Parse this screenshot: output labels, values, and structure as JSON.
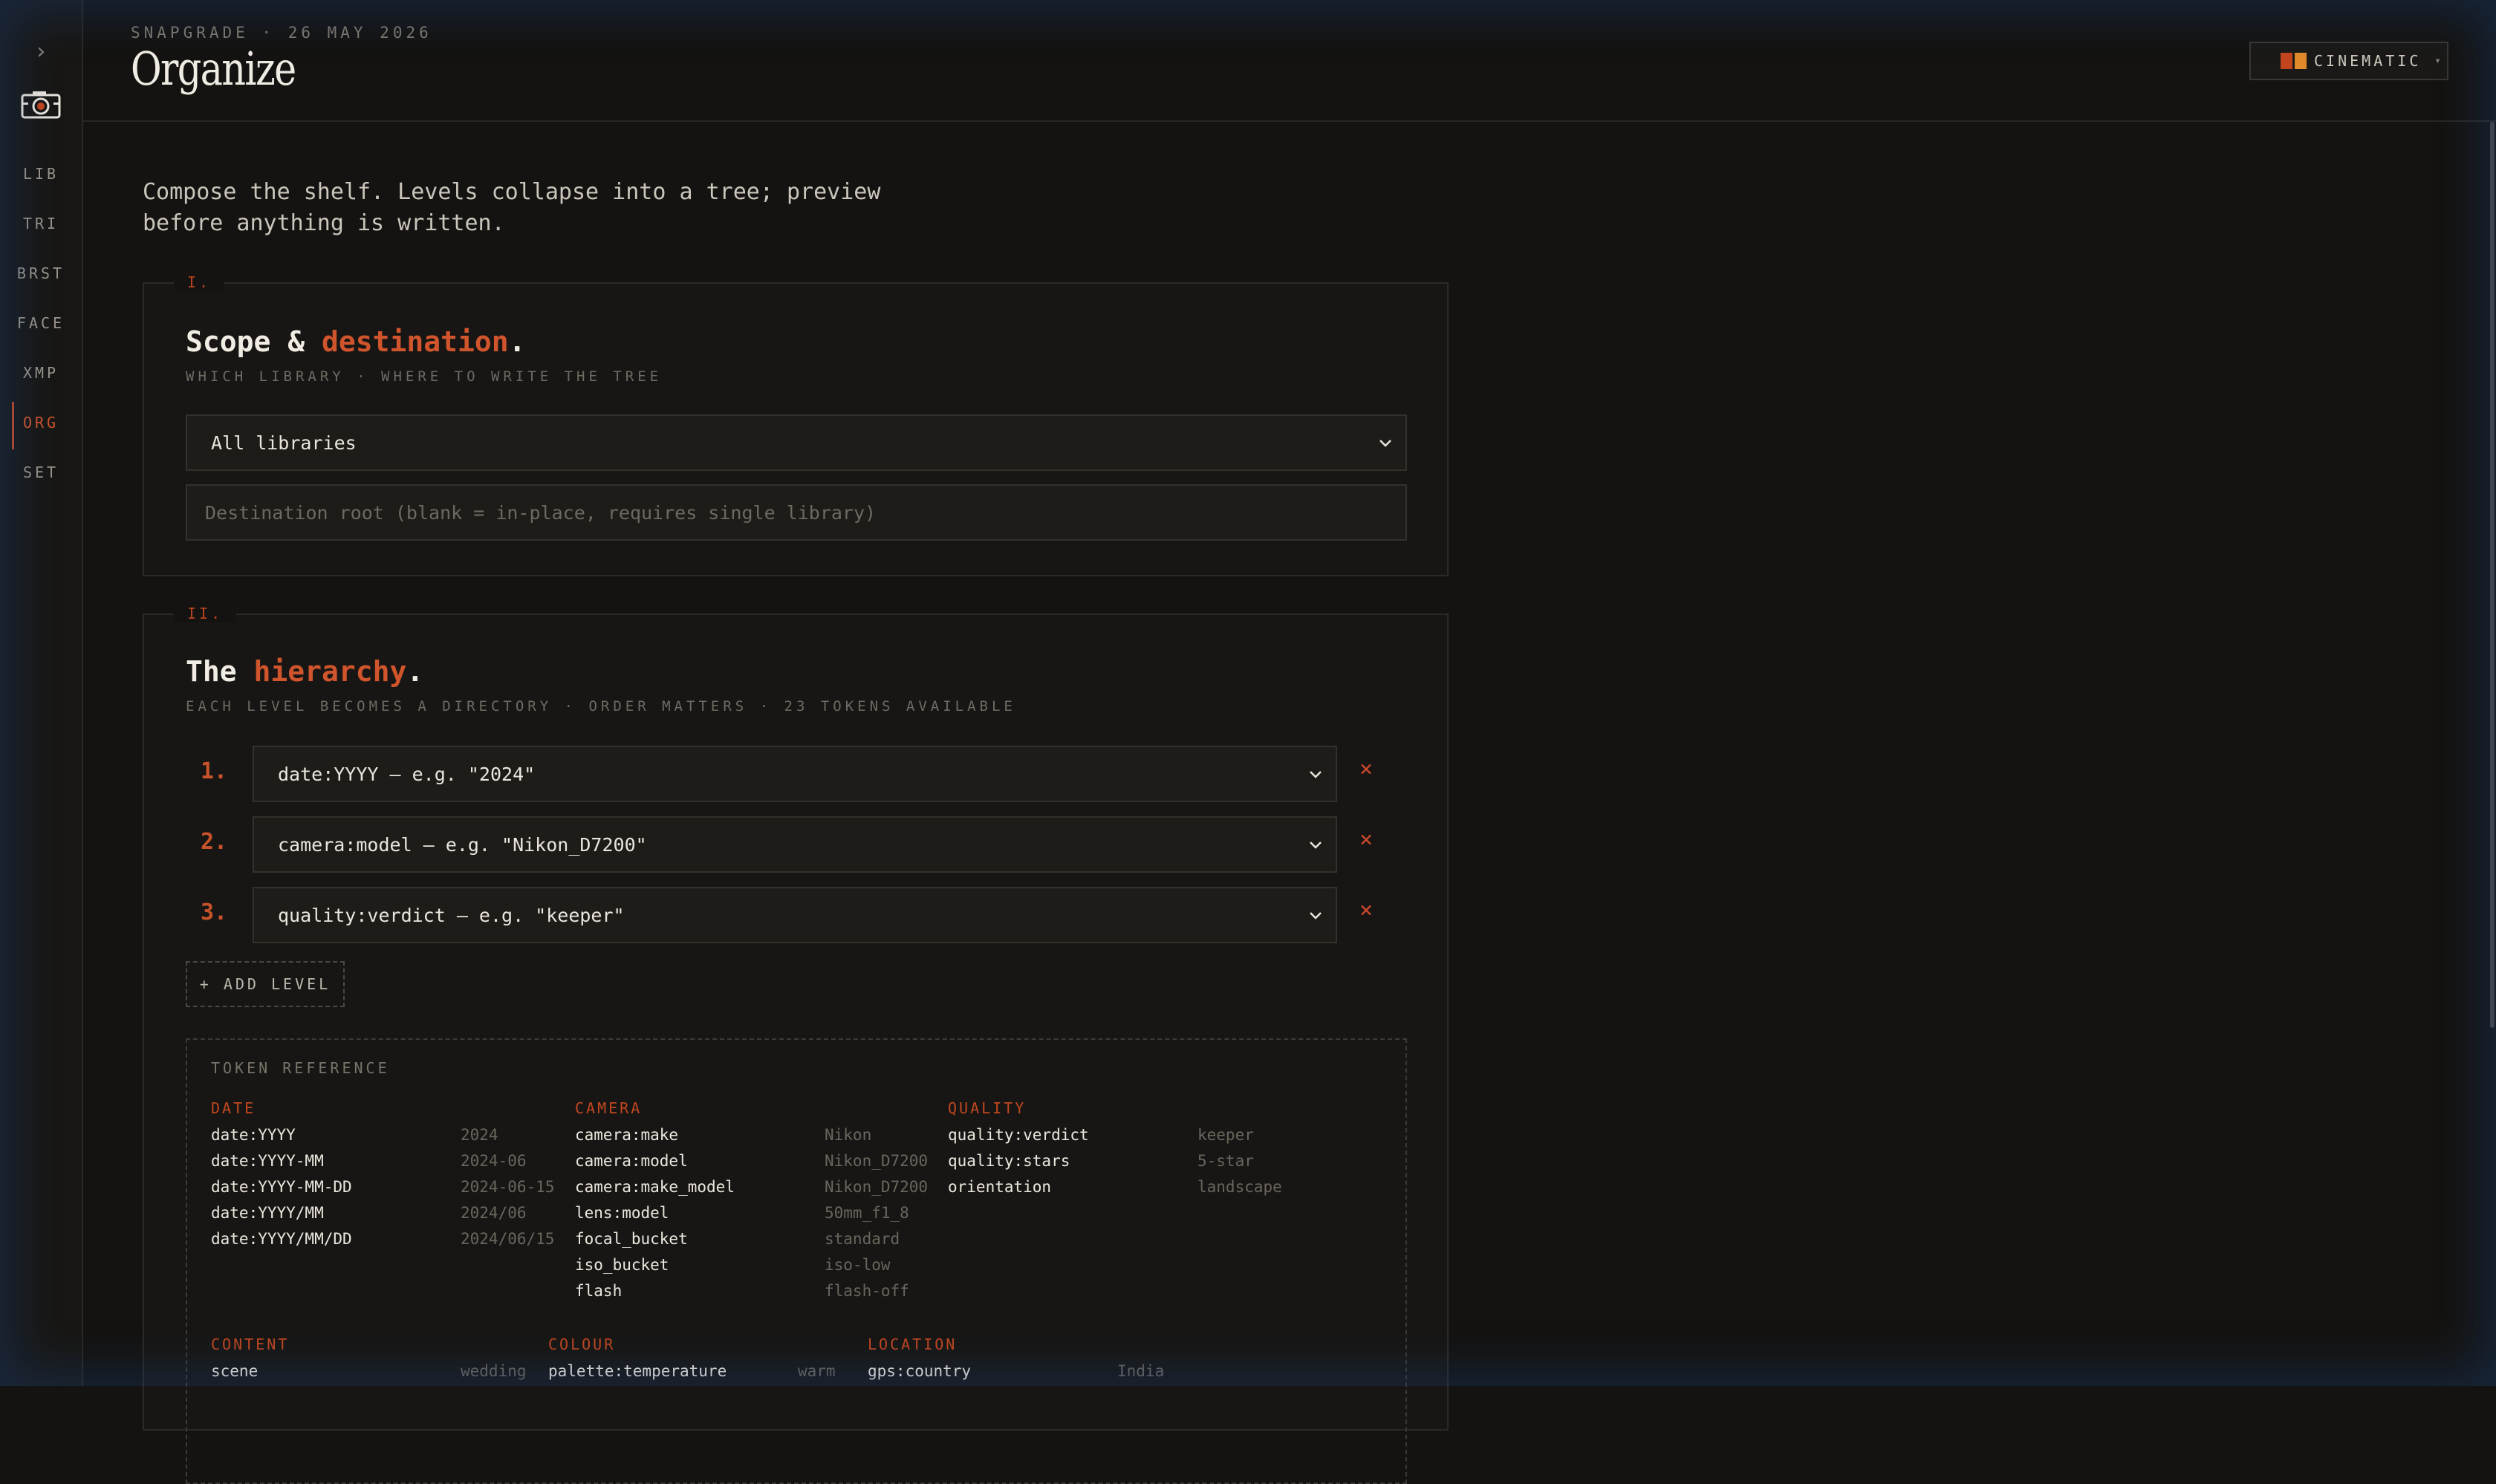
{
  "sidebar": {
    "toggle": "›",
    "nav": [
      {
        "label": "LIB",
        "active": false
      },
      {
        "label": "TRI",
        "active": false
      },
      {
        "label": "BRST",
        "active": false
      },
      {
        "label": "FACE",
        "active": false
      },
      {
        "label": "XMP",
        "active": false
      },
      {
        "label": "ORG",
        "active": true
      },
      {
        "label": "SET",
        "active": false
      }
    ]
  },
  "header": {
    "kicker": "SNAPGRADE · 26 MAY 2026",
    "title": "Organize",
    "theme": {
      "label": "CINEMATIC",
      "caret": "▾",
      "swatch_colors": [
        "#c2451e",
        "#e08a2c"
      ]
    }
  },
  "intro": "Compose the shelf. Levels collapse into a tree; preview before anything is written.",
  "scope": {
    "numeral": "I.",
    "title_plain": "Scope & ",
    "title_accent": "destination",
    "title_end": ".",
    "subtitle": "WHICH LIBRARY · WHERE TO WRITE THE TREE",
    "library_select": "All libraries",
    "destination_placeholder": "Destination root (blank = in-place, requires single library)"
  },
  "hierarchy": {
    "numeral": "II.",
    "title_plain": "The ",
    "title_accent": "hierarchy",
    "title_end": ".",
    "subtitle": "EACH LEVEL BECOMES A DIRECTORY · ORDER MATTERS · 23 TOKENS AVAILABLE",
    "levels": [
      {
        "num": "1.",
        "value": "date:YYYY — e.g. \"2024\"",
        "remove": "×"
      },
      {
        "num": "2.",
        "value": "camera:model — e.g. \"Nikon_D7200\"",
        "remove": "×"
      },
      {
        "num": "3.",
        "value": "quality:verdict — e.g. \"keeper\"",
        "remove": "×"
      }
    ],
    "add_level": "+ ADD LEVEL"
  },
  "token_reference": {
    "label": "TOKEN REFERENCE",
    "groups": [
      {
        "head": "DATE",
        "tokens": [
          {
            "name": "date:YYYY",
            "ex": "2024"
          },
          {
            "name": "date:YYYY-MM",
            "ex": "2024-06"
          },
          {
            "name": "date:YYYY-MM-DD",
            "ex": "2024-06-15"
          },
          {
            "name": "date:YYYY/MM",
            "ex": "2024/06"
          },
          {
            "name": "date:YYYY/MM/DD",
            "ex": "2024/06/15"
          }
        ]
      },
      {
        "head": "CAMERA",
        "tokens": [
          {
            "name": "camera:make",
            "ex": "Nikon"
          },
          {
            "name": "camera:model",
            "ex": "Nikon_D7200"
          },
          {
            "name": "camera:make_model",
            "ex": "Nikon_D7200"
          },
          {
            "name": "lens:model",
            "ex": "50mm_f1_8"
          },
          {
            "name": "focal_bucket",
            "ex": "standard"
          },
          {
            "name": "iso_bucket",
            "ex": "iso-low"
          },
          {
            "name": "flash",
            "ex": "flash-off"
          }
        ]
      },
      {
        "head": "QUALITY",
        "tokens": [
          {
            "name": "quality:verdict",
            "ex": "keeper"
          },
          {
            "name": "quality:stars",
            "ex": "5-star"
          },
          {
            "name": "orientation",
            "ex": "landscape"
          }
        ]
      },
      {
        "head": "CONTENT",
        "tokens": [
          {
            "name": "scene",
            "ex": "wedding"
          }
        ]
      },
      {
        "head": "COLOUR",
        "tokens": [
          {
            "name": "palette:temperature",
            "ex": "warm"
          }
        ]
      },
      {
        "head": "LOCATION",
        "tokens": [
          {
            "name": "gps:country",
            "ex": "India"
          }
        ]
      }
    ]
  }
}
